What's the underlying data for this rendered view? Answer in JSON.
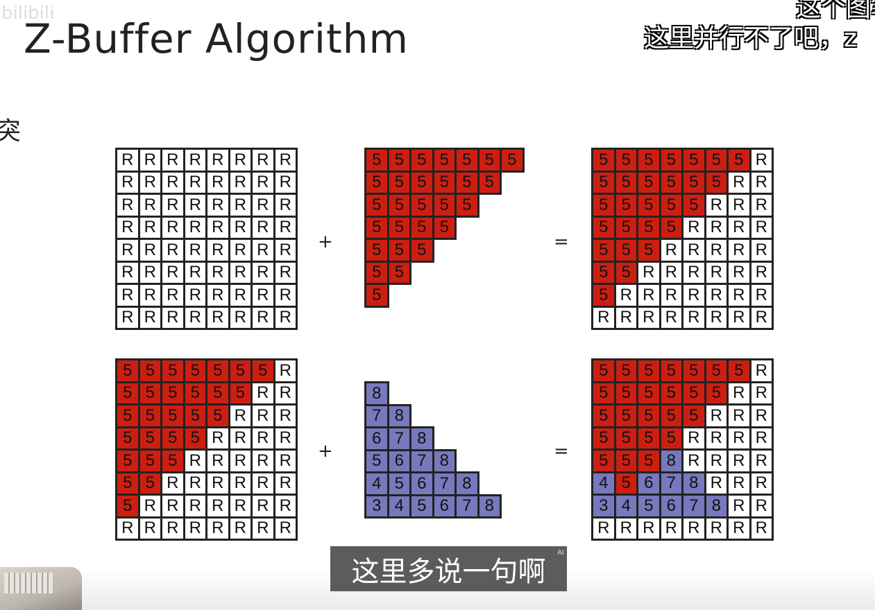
{
  "slide": {
    "title": "Z-Buffer Algorithm"
  },
  "overlay": {
    "watermark": "bilibili",
    "danmaku_top": "这个图笔",
    "danmaku_main": "这里并行不了吧，z",
    "left_fragment": "突",
    "subtitle": "这里多说一句啊",
    "ai_tag": "AI"
  },
  "operators": {
    "plus": "+",
    "equals": "="
  },
  "colors": {
    "red": "#cc1f12",
    "blue": "#7779bd",
    "border": "#222222"
  },
  "grids": [
    {
      "name": "grid-initial-depth",
      "rows": [
        "RRRRRRRR",
        "RRRRRRRR",
        "RRRRRRRR",
        "RRRRRRRR",
        "RRRRRRRR",
        "RRRRRRRR",
        "RRRRRRRR",
        "RRRRRRRR"
      ],
      "fill": ""
    },
    {
      "name": "grid-red-triangle",
      "rows": [
        "5555555 ",
        "555555  ",
        "55555   ",
        "5555    ",
        "555     ",
        "55      ",
        "5       "
      ],
      "fill": "red"
    },
    {
      "name": "grid-result-1",
      "rows": [
        "5555555R",
        "555555RR",
        "55555RRR",
        "5555RRRR",
        "555RRRRR",
        "55RRRRRR",
        "5RRRRRRR",
        "RRRRRRRR"
      ],
      "fill": ""
    },
    {
      "name": "grid-current-depth",
      "rows": [
        "5555555R",
        "555555RR",
        "55555RRR",
        "5555RRRR",
        "555RRRRR",
        "55RRRRRR",
        "5RRRRRRR",
        "RRRRRRRR"
      ],
      "fill": ""
    },
    {
      "name": "grid-blue-triangle",
      "rows": [
        "8     ",
        "78    ",
        "678   ",
        "5678  ",
        "45678 ",
        "345678"
      ],
      "fill": "blue"
    },
    {
      "name": "grid-result-2",
      "rows": [
        "5555555R",
        "555555RR",
        "55555RRR",
        "5555RRRR",
        "5558RRRR",
        "45678RRR",
        "345678RR",
        "RRRRRRRR"
      ],
      "blue_cells": [
        "4-3",
        "5-0",
        "5-2",
        "5-3",
        "5-4",
        "6-0",
        "6-1",
        "6-2",
        "6-3",
        "6-4",
        "6-5"
      ]
    }
  ]
}
